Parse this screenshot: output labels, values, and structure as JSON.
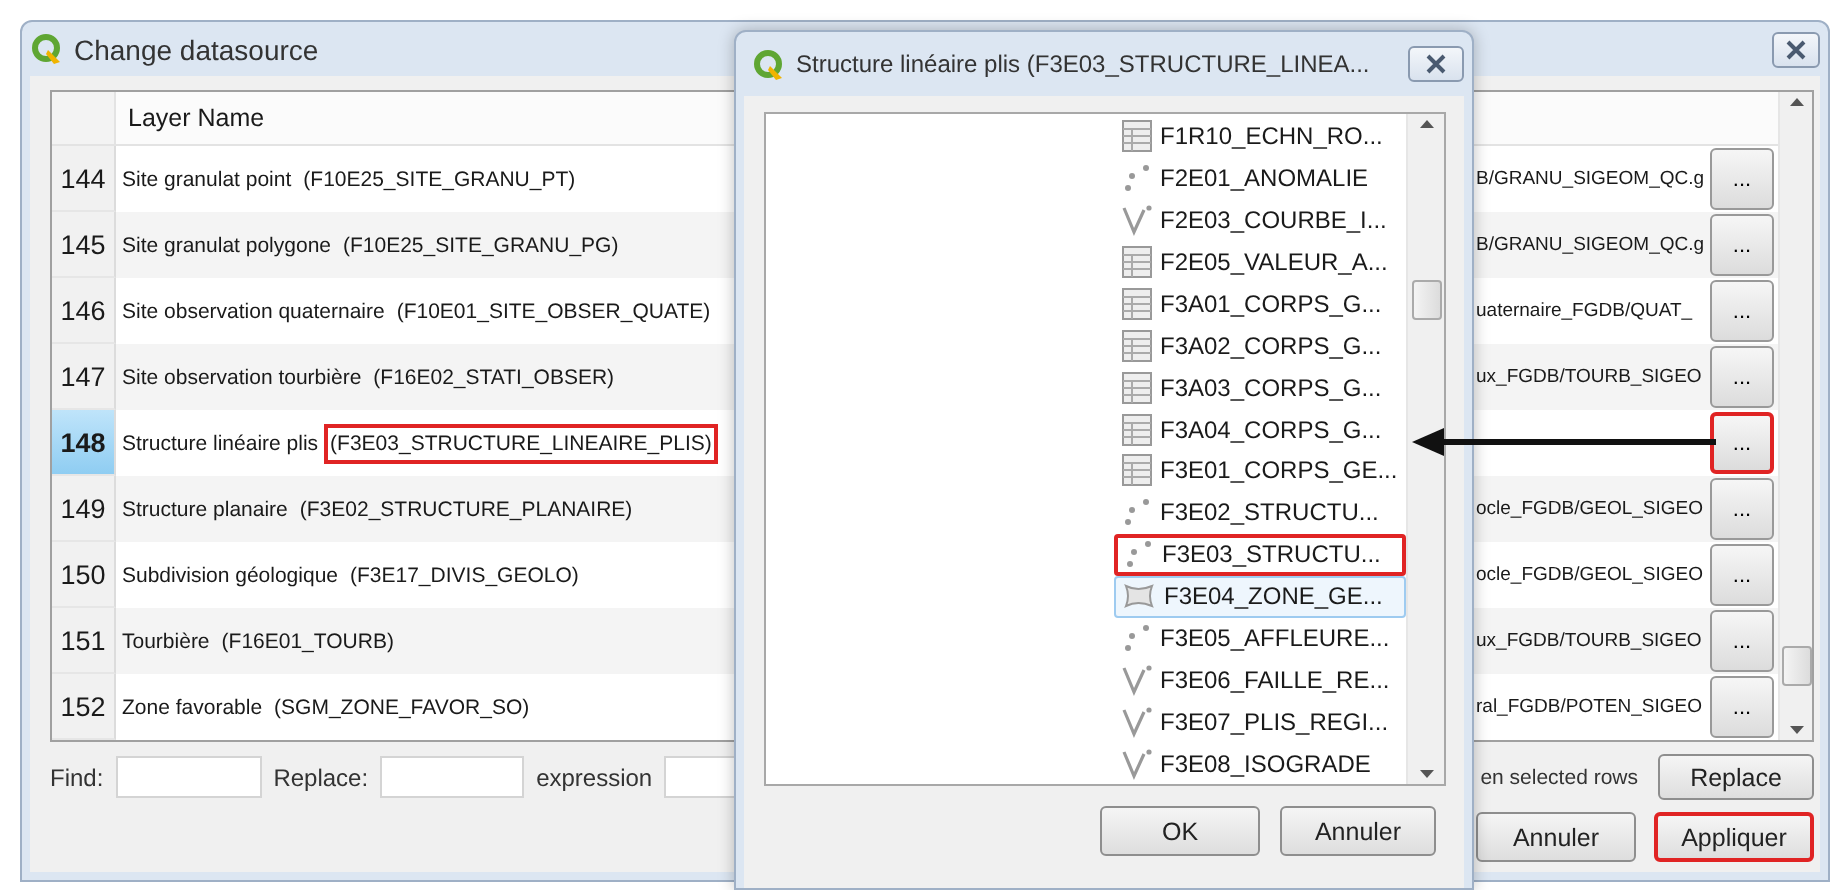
{
  "main_window": {
    "title": "Change datasource",
    "table": {
      "columns": [
        "Layer Name"
      ],
      "rows": [
        {
          "number": "144",
          "layer": "Site granulat point",
          "source": "(F10E25_SITE_GRANU_PT)",
          "path": "B/GRANU_SIGEOM_QC.g",
          "button": "...",
          "selected": false,
          "marked": false
        },
        {
          "number": "145",
          "layer": "Site granulat polygone",
          "source": "(F10E25_SITE_GRANU_PG)",
          "path": "B/GRANU_SIGEOM_QC.g",
          "button": "...",
          "selected": false,
          "marked": false
        },
        {
          "number": "146",
          "layer": "Site observation quaternaire",
          "source": "(F10E01_SITE_OBSER_QUATE)",
          "path": "uaternaire_FGDB/QUAT_",
          "button": "...",
          "selected": false,
          "marked": false
        },
        {
          "number": "147",
          "layer": "Site observation tourbière",
          "source": "(F16E02_STATI_OBSER)",
          "path": "ux_FGDB/TOURB_SIGEO",
          "button": "...",
          "selected": false,
          "marked": false
        },
        {
          "number": "148",
          "layer": "Structure linéaire plis",
          "source": "(F3E03_STRUCTURE_LINEAIRE_PLIS)",
          "button": "...",
          "selected": true,
          "marked": true
        },
        {
          "number": "149",
          "layer": "Structure planaire",
          "source": "(F3E02_STRUCTURE_PLANAIRE)",
          "path": "ocle_FGDB/GEOL_SIGEO",
          "button": "...",
          "selected": false,
          "marked": false
        },
        {
          "number": "150",
          "layer": "Subdivision géologique",
          "source": "(F3E17_DIVIS_GEOLO)",
          "path": "ocle_FGDB/GEOL_SIGEO",
          "button": "...",
          "selected": false,
          "marked": false
        },
        {
          "number": "151",
          "layer": "Tourbière",
          "source": "(F16E01_TOURB)",
          "path": "ux_FGDB/TOURB_SIGEO",
          "button": "...",
          "selected": false,
          "marked": false
        },
        {
          "number": "152",
          "layer": "Zone favorable",
          "source": "(SGM_ZONE_FAVOR_SO)",
          "path": "ral_FGDB/POTEN_SIGEO",
          "button": "...",
          "selected": false,
          "marked": false
        }
      ]
    },
    "find_bar": {
      "find_label": "Find:",
      "replace_label": "Replace:",
      "expression_label": "expression",
      "selected_rows_text": "en selected rows",
      "replace_button": "Replace"
    },
    "buttons": [
      {
        "label": "Annuler",
        "marked": false
      },
      {
        "label": "Appliquer",
        "marked": true
      }
    ]
  },
  "dialog": {
    "title": "Structure linéaire plis (F3E03_STRUCTURE_LINEA...",
    "items": [
      {
        "kind": "table",
        "label": "F1R10_ECHN_RO...",
        "selected": false,
        "marked": false
      },
      {
        "kind": "point",
        "label": "F2E01_ANOMALIE",
        "selected": false,
        "marked": false
      },
      {
        "kind": "line",
        "label": "F2E03_COURBE_I...",
        "selected": false,
        "marked": false
      },
      {
        "kind": "table",
        "label": "F2E05_VALEUR_A...",
        "selected": false,
        "marked": false
      },
      {
        "kind": "table",
        "label": "F3A01_CORPS_G...",
        "selected": false,
        "marked": false
      },
      {
        "kind": "table",
        "label": "F3A02_CORPS_G...",
        "selected": false,
        "marked": false
      },
      {
        "kind": "table",
        "label": "F3A03_CORPS_G...",
        "selected": false,
        "marked": false
      },
      {
        "kind": "table",
        "label": "F3A04_CORPS_G...",
        "selected": false,
        "marked": false
      },
      {
        "kind": "table",
        "label": "F3E01_CORPS_GE...",
        "selected": false,
        "marked": false
      },
      {
        "kind": "point",
        "label": "F3E02_STRUCTU...",
        "selected": false,
        "marked": false
      },
      {
        "kind": "point",
        "label": "F3E03_STRUCTU...",
        "selected": false,
        "marked": true
      },
      {
        "kind": "polygon",
        "label": "F3E04_ZONE_GE...",
        "selected": true,
        "marked": false
      },
      {
        "kind": "point",
        "label": "F3E05_AFFLEURE...",
        "selected": false,
        "marked": false
      },
      {
        "kind": "line",
        "label": "F3E06_FAILLE_RE...",
        "selected": false,
        "marked": false
      },
      {
        "kind": "line",
        "label": "F3E07_PLIS_REGI...",
        "selected": false,
        "marked": false
      },
      {
        "kind": "line",
        "label": "F3E08_ISOGRADE",
        "selected": false,
        "marked": false
      }
    ],
    "buttons": [
      "OK",
      "Annuler"
    ]
  }
}
